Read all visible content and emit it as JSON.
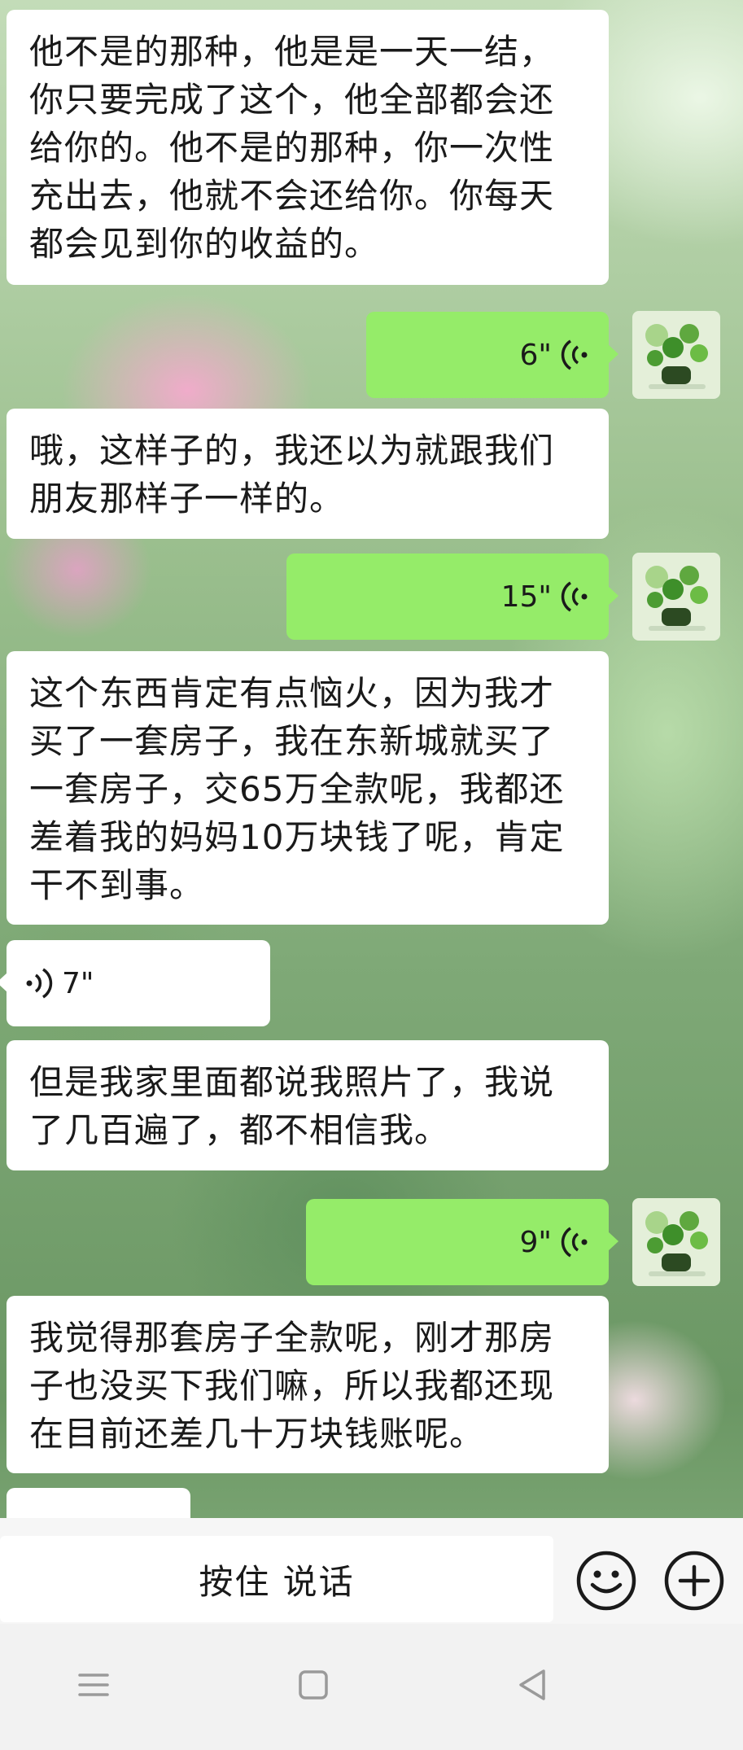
{
  "messages": [
    {
      "side": "in",
      "type": "text",
      "text": "他不是的那种，他是是一天一结，你只要完成了这个，他全部都会还给你的。他不是的那种，你一次性充出去，他就不会还给你。你每天都会见到你的收益的。"
    },
    {
      "side": "out",
      "type": "voice",
      "duration": "6\""
    },
    {
      "side": "in",
      "type": "text",
      "text": "哦，这样子的，我还以为就跟我们朋友那样子一样的。"
    },
    {
      "side": "out",
      "type": "voice",
      "duration": "15\""
    },
    {
      "side": "in",
      "type": "text",
      "text": "这个东西肯定有点恼火，因为我才买了一套房子，我在东新城就买了一套房子，交65万全款呢，我都还差着我的妈妈10万块钱了呢，肯定干不到事。"
    },
    {
      "side": "in",
      "type": "voice",
      "duration": "7\""
    },
    {
      "side": "in",
      "type": "text",
      "text": "但是我家里面都说我照片了，我说了几百遍了，都不相信我。"
    },
    {
      "side": "out",
      "type": "voice",
      "duration": "9\""
    },
    {
      "side": "in",
      "type": "text",
      "text": "我觉得那套房子全款呢，刚才那房子也没买下我们嘛，所以我都还现在目前还差几十万块钱账呢。"
    }
  ],
  "input_bar": {
    "talk_label": "按住 说话",
    "emoji_icon": "emoji-icon",
    "add_icon": "plus-icon"
  },
  "nav_bar": {
    "menu_icon": "menu-icon",
    "home_icon": "home-icon",
    "back_icon": "back-icon"
  },
  "colors": {
    "outgoing_bubble": "#95ec69",
    "incoming_bubble": "#ffffff"
  }
}
